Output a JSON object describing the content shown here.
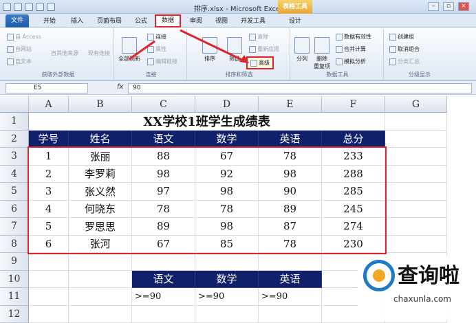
{
  "window": {
    "title": "排序.xlsx - Microsoft Excel",
    "table_tools": "表格工具"
  },
  "tabs": [
    "开始",
    "插入",
    "页面布局",
    "公式",
    "数据",
    "审阅",
    "视图",
    "开发工具",
    "设计"
  ],
  "file_tab": "文件",
  "ribbon": {
    "get_external": {
      "label": "获取外部数据",
      "access": "自 Access",
      "web": "自网站",
      "text": "自文本",
      "other": "自其他来源",
      "existing": "现有连接"
    },
    "connections": {
      "label": "连接",
      "refresh_all": "全部刷新",
      "connections": "连接",
      "properties": "属性",
      "edit_links": "编辑链接"
    },
    "sort_filter": {
      "label": "排序和筛选",
      "sort": "排序",
      "filter": "筛选",
      "clear": "清除",
      "reapply": "重新应用",
      "advanced": "高级"
    },
    "data_tools": {
      "label": "数据工具",
      "split": "分列",
      "remove_dup": "删除\n重复项",
      "validation": "数据有效性",
      "consolidate": "合并计算",
      "whatif": "模拟分析"
    },
    "outline": {
      "label": "分级显示",
      "group": "创建组",
      "ungroup": "取消组合",
      "subtotal": "分类汇总"
    }
  },
  "formula_bar": {
    "name_box": "E5",
    "fx": "fx",
    "value": "90"
  },
  "grid": {
    "columns": [
      "A",
      "B",
      "C",
      "D",
      "E",
      "F",
      "G"
    ],
    "rows": [
      "1",
      "2",
      "3",
      "4",
      "5",
      "6",
      "7",
      "8",
      "9",
      "10",
      "11",
      "12"
    ],
    "title": "XX学校1班学生成绩表",
    "headers": [
      "学号",
      "姓名",
      "语文",
      "数学",
      "英语",
      "总分"
    ],
    "records": [
      [
        "1",
        "张丽",
        "88",
        "67",
        "78",
        "233"
      ],
      [
        "2",
        "李罗莉",
        "98",
        "92",
        "98",
        "288"
      ],
      [
        "3",
        "张义然",
        "97",
        "98",
        "90",
        "285"
      ],
      [
        "4",
        "何晓东",
        "78",
        "78",
        "89",
        "245"
      ],
      [
        "5",
        "罗思思",
        "89",
        "98",
        "87",
        "274"
      ],
      [
        "6",
        "张河",
        "67",
        "85",
        "78",
        "230"
      ]
    ],
    "criteria_headers": [
      "语文",
      "数学",
      "英语"
    ],
    "criteria_values": [
      ">=90",
      ">=90",
      ">=90"
    ]
  },
  "watermark": {
    "text": "查询啦",
    "url": "chaxunla.com"
  }
}
